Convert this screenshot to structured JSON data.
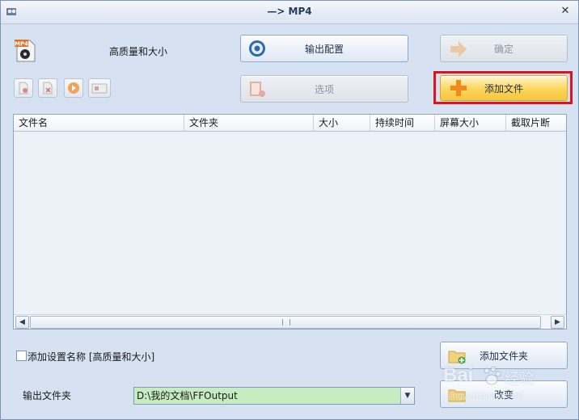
{
  "window": {
    "title": "—> MP4",
    "close_glyph": "✕"
  },
  "profile": {
    "icon": "mp4-file-icon",
    "icon_text": "MP4",
    "name": "高质量和大小"
  },
  "buttons": {
    "output_config": "输出配置",
    "ok": "确定",
    "options": "选项",
    "add_file": "添加文件",
    "add_folder": "添加文件夹",
    "change": "改变"
  },
  "table": {
    "columns": [
      "文件名",
      "文件夹",
      "大小",
      "持续时间",
      "屏幕大小",
      "截取片断"
    ],
    "rows": []
  },
  "checkbox": {
    "label": "添加设置名称 [高质量和大小]",
    "checked": false
  },
  "output_folder": {
    "label": "输出文件夹",
    "value": "D:\\我的文档\\FFOutput"
  },
  "watermark": {
    "text": "Bai",
    "text2": "经验",
    "url": "jingyan.baidu.com"
  },
  "colors": {
    "window_bg": "#d6e2f1",
    "path_bg": "#c7ecc1",
    "highlight": "#e0121b",
    "add_icon": "#f08a1c"
  }
}
